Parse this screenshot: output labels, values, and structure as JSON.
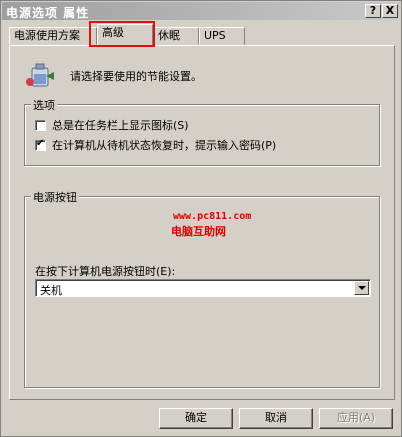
{
  "window": {
    "title": "电源选项 属性",
    "help_label": "?",
    "close_label": "X"
  },
  "tabs": [
    {
      "label": "电源使用方案"
    },
    {
      "label": "高级"
    },
    {
      "label": "休眠"
    },
    {
      "label": "UPS"
    }
  ],
  "active_tab": "高级",
  "intro_text": "请选择要使用的节能设置。",
  "options": {
    "legend": "选项",
    "items": [
      {
        "label": "总是在任务栏上显示图标(S)",
        "checked": false
      },
      {
        "label": "在计算机从待机状态恢复时，提示输入密码(P)",
        "checked": true
      }
    ]
  },
  "power_buttons": {
    "legend": "电源按钮",
    "select_label": "在按下计算机电源按钮时(E):",
    "select_value": "关机"
  },
  "watermark": {
    "url": "www.pc811.com",
    "name": "电脑互助网"
  },
  "buttons": {
    "ok": "确定",
    "cancel": "取消",
    "apply": "应用(A)"
  },
  "colors": {
    "face": "#d4d0c8",
    "highlight_box": "#e01010",
    "watermark": "#e00000"
  }
}
